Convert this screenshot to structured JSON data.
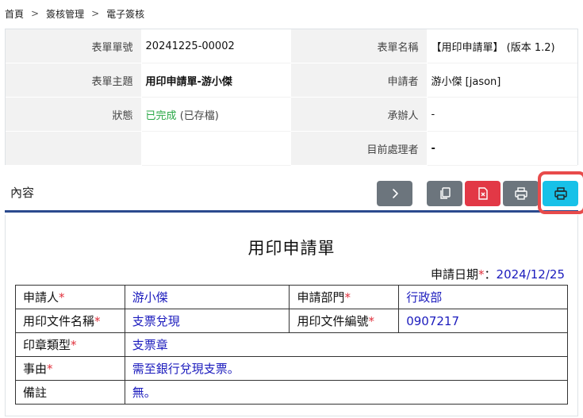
{
  "breadcrumb": [
    "首頁",
    "簽核管理",
    "電子簽核"
  ],
  "info": {
    "form_no_label": "表單單號",
    "form_no": "20241225-00002",
    "form_name_label": "表單名稱",
    "form_name": "【用印申請單】 (版本 1.2)",
    "subject_label": "表單主題",
    "subject": "用印申請單-游小傑",
    "applicant_label": "申請者",
    "applicant": "游小傑 [jason]",
    "status_label": "狀態",
    "status": "已完成",
    "status_note": "(已存檔)",
    "handler_label": "承辦人",
    "handler": "-",
    "current_label": "目前處理者",
    "current": "-"
  },
  "section": {
    "title": "內容",
    "buttons": [
      "next-icon",
      "copy-icon",
      "delete-icon",
      "print-icon",
      "print-icon"
    ],
    "colors": {
      "gray": "#6c757d",
      "red": "#e23846",
      "cyan": "#17c1e8",
      "highlight": "#e84b4b",
      "divider": "#2b4a8e"
    }
  },
  "form": {
    "title": "用印申請單",
    "date_label": "申請日期",
    "date_star": "*",
    "date_colon": "：",
    "date": "2024/12/25",
    "star": "*",
    "rows": {
      "applicant_label": "申請人",
      "applicant": "游小傑",
      "dept_label": "申請部門",
      "dept": "行政部",
      "doc_name_label": "用印文件名稱",
      "doc_name": "支票兌現",
      "doc_no_label": "用印文件編號",
      "doc_no": "0907217",
      "seal_label": "印章類型",
      "seal": "支票章",
      "reason_label": "事由",
      "reason": "需至銀行兌現支票。",
      "note_label": "備註",
      "note": "無。"
    }
  }
}
